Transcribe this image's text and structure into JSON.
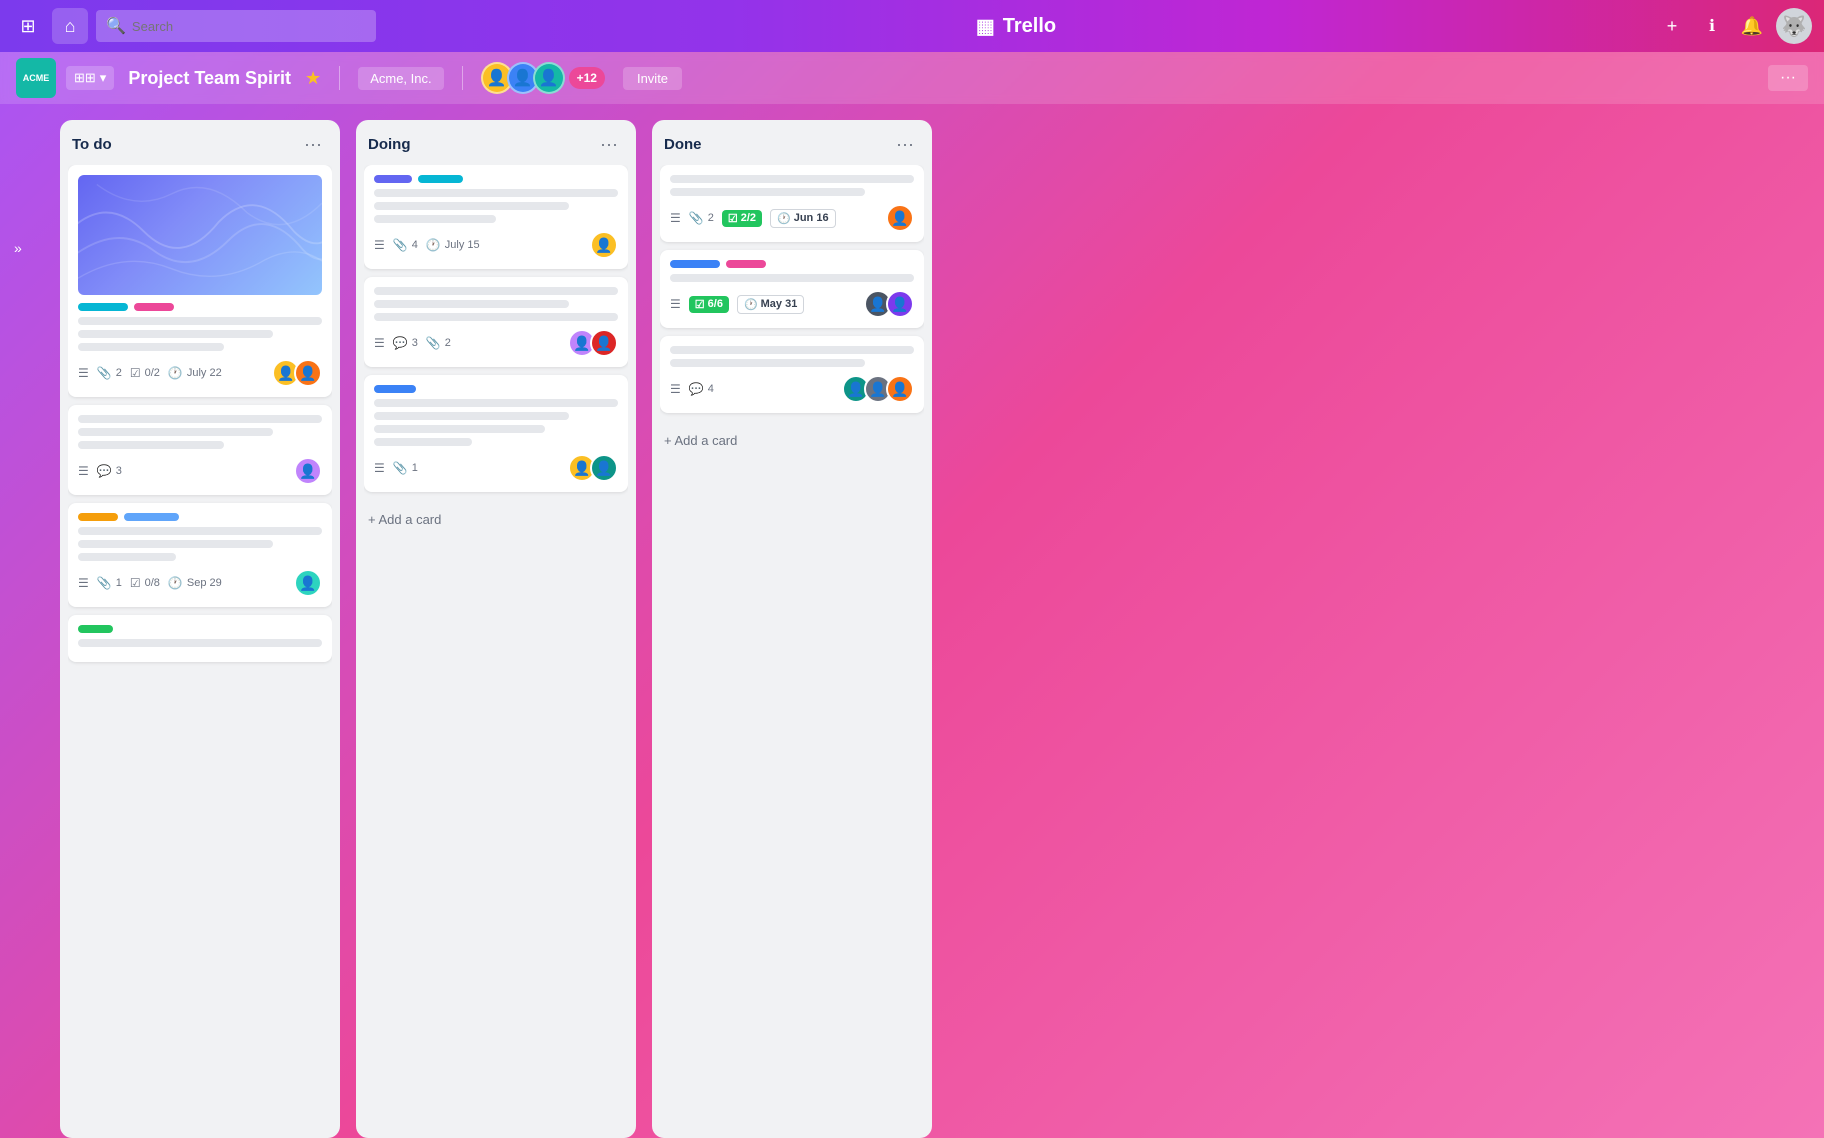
{
  "app": {
    "name": "Trello",
    "logo_icon": "▦"
  },
  "nav": {
    "grid_icon": "⊞",
    "home_icon": "⌂",
    "search_placeholder": "Search",
    "plus_icon": "+",
    "info_icon": "ℹ",
    "bell_icon": "🔔"
  },
  "board": {
    "workspace_badge": "ACME",
    "dropdown_icon": "▾",
    "title": "Project Team Spirit",
    "star_icon": "★",
    "workspace_name": "Acme, Inc.",
    "member_count": "+12",
    "invite_label": "Invite",
    "more_icon": "···"
  },
  "sidebar": {
    "toggle_icon": "»"
  },
  "lists": [
    {
      "id": "todo",
      "title": "To do",
      "menu_icon": "···",
      "cards": [
        {
          "id": "todo-1",
          "has_cover": true,
          "tags": [
            "cyan",
            "pink"
          ],
          "meta_desc": true,
          "attachments": 2,
          "checklist": "0/2",
          "date": "July 22",
          "avatars": [
            "yellow",
            "orange"
          ]
        },
        {
          "id": "todo-2",
          "has_cover": false,
          "tags": [],
          "meta_desc": true,
          "comments": 3,
          "avatars": [
            "purple"
          ]
        },
        {
          "id": "todo-3",
          "has_cover": false,
          "tags": [
            "yellow",
            "blue2"
          ],
          "meta_desc": true,
          "attachments": 1,
          "checklist": "0/8",
          "date": "Sep 29",
          "avatars": [
            "teal"
          ]
        },
        {
          "id": "todo-4",
          "has_cover": false,
          "tags": [
            "green"
          ],
          "meta_desc": false,
          "avatars": []
        }
      ],
      "add_card_label": "+ Add a card"
    },
    {
      "id": "doing",
      "title": "Doing",
      "menu_icon": "···",
      "cards": [
        {
          "id": "doing-1",
          "tags": [
            "blue-dark",
            "cyan"
          ],
          "meta_desc": true,
          "attachments": 4,
          "date": "July 15",
          "avatars": [
            "yellow"
          ]
        },
        {
          "id": "doing-2",
          "tags": [],
          "meta_desc": true,
          "comments": 3,
          "attachments": 2,
          "avatars": [
            "purple",
            "red"
          ]
        },
        {
          "id": "doing-3",
          "tags": [
            "blue3"
          ],
          "meta_desc": true,
          "attachments": 1,
          "avatars": [
            "yellow",
            "teal"
          ]
        }
      ],
      "add_card_label": "+ Add a card"
    },
    {
      "id": "done",
      "title": "Done",
      "menu_icon": "···",
      "cards": [
        {
          "id": "done-1",
          "tags": [],
          "meta_desc": true,
          "attachments": 2,
          "badge_check": "2/2",
          "badge_date": "Jun 16",
          "avatars": [
            "orange-red"
          ]
        },
        {
          "id": "done-2",
          "tags": [
            "blue",
            "pink"
          ],
          "meta_desc": true,
          "badge_check": "6/6",
          "badge_date": "May 31",
          "avatars": [
            "dark",
            "purple2"
          ]
        },
        {
          "id": "done-3",
          "tags": [],
          "meta_desc": true,
          "comments": 4,
          "avatars": [
            "teal2",
            "dark2",
            "orange2"
          ]
        }
      ],
      "add_card_label": "+ Add a card"
    }
  ]
}
